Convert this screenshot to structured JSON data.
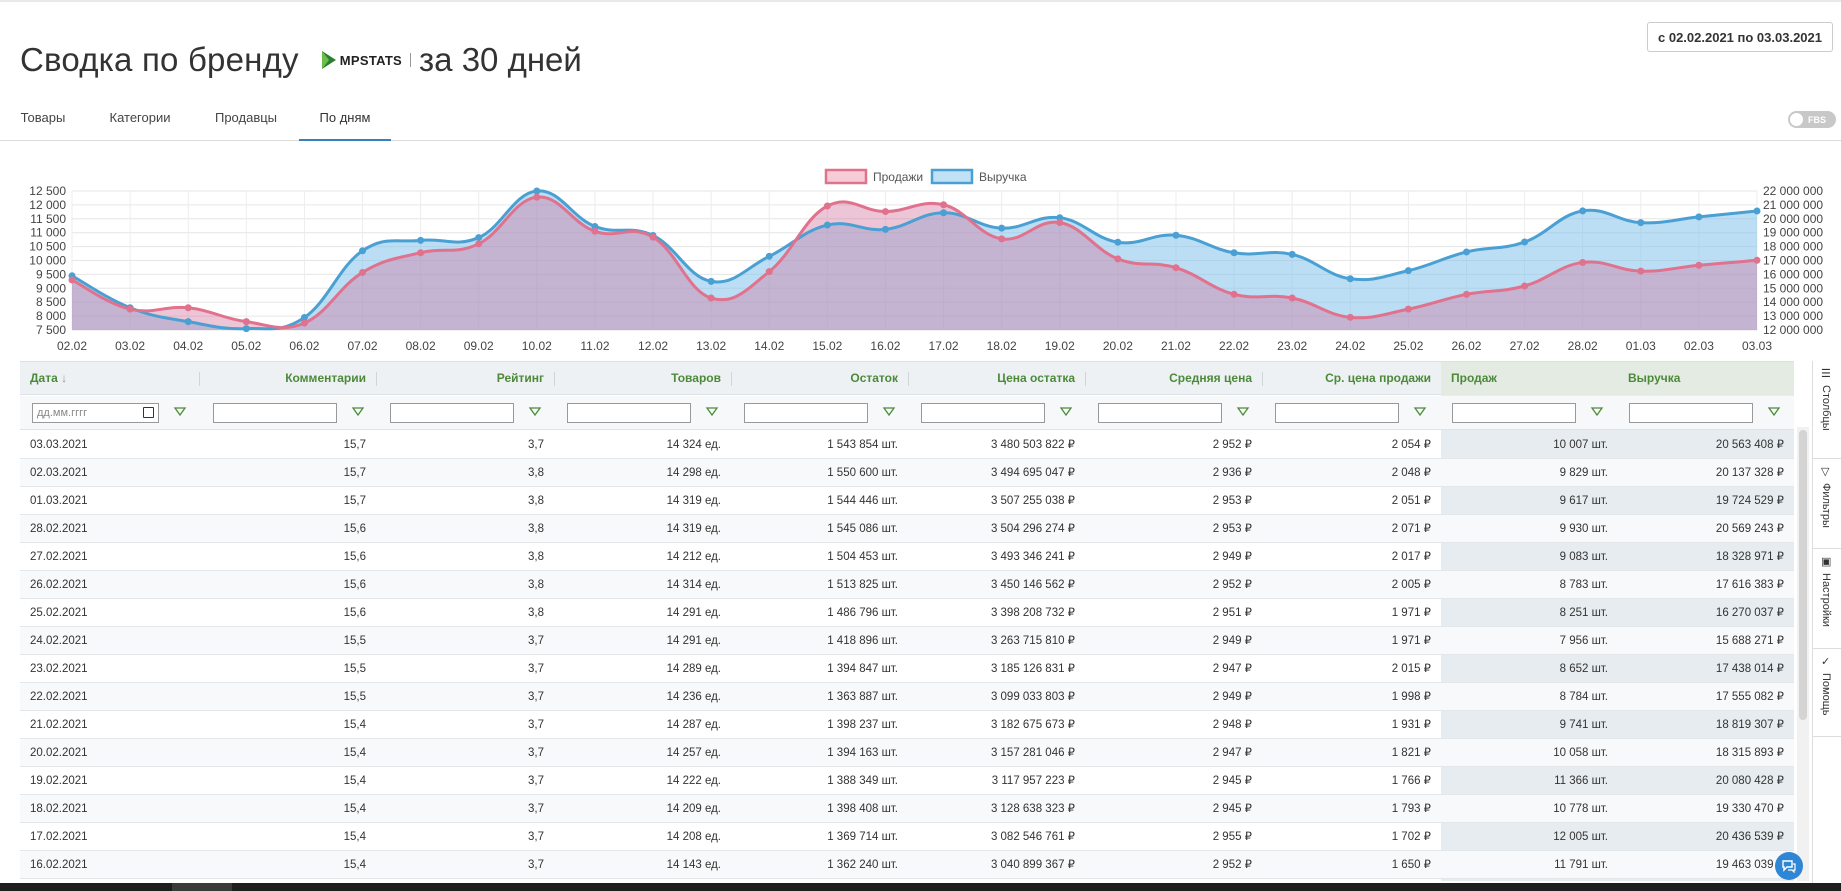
{
  "header": {
    "title": "Сводка по бренду",
    "logo_text": "MPSTATS",
    "title_suffix": "за 30 дней",
    "date_range": "с 02.02.2021 по 03.03.2021"
  },
  "tabs": [
    {
      "label": "Товары",
      "active": false
    },
    {
      "label": "Категории",
      "active": false
    },
    {
      "label": "Продавцы",
      "active": false
    },
    {
      "label": "По дням",
      "active": true
    }
  ],
  "fbs_toggle": {
    "label": "FBS",
    "on": false
  },
  "colors": {
    "accent": "#3a7fbd",
    "sales": "#e0728d",
    "revenue": "#4aa0d2",
    "header_text": "#4c8a3a"
  },
  "chart_data": {
    "type": "area",
    "legend": [
      "Продажи",
      "Выручка"
    ],
    "legend_position": "top-center",
    "x": [
      "02.02",
      "03.02",
      "04.02",
      "05.02",
      "06.02",
      "07.02",
      "08.02",
      "09.02",
      "10.02",
      "11.02",
      "12.02",
      "13.02",
      "14.02",
      "15.02",
      "16.02",
      "17.02",
      "18.02",
      "19.02",
      "20.02",
      "21.02",
      "22.02",
      "23.02",
      "24.02",
      "25.02",
      "26.02",
      "27.02",
      "28.02",
      "01.03",
      "02.03",
      "03.03"
    ],
    "y_left_ticks": [
      "12 500",
      "12 000",
      "11 500",
      "11 000",
      "10 500",
      "10 000",
      "9 500",
      "9 000",
      "8 500",
      "8 000",
      "7 500"
    ],
    "y_right_ticks": [
      "22 000 000",
      "21 000 000",
      "20 000 000",
      "19 000 000",
      "18 000 000",
      "17 000 000",
      "16 000 000",
      "15 000 000",
      "14 000 000",
      "13 000 000",
      "12 000 000"
    ],
    "ylim_left": [
      7500,
      12500
    ],
    "ylim_right": [
      12000000,
      22000000
    ],
    "grid": true,
    "series": [
      {
        "name": "Продажи",
        "axis": "left",
        "values": [
          9300,
          8250,
          8300,
          7800,
          7750,
          9570,
          10280,
          10600,
          12280,
          11050,
          10840,
          8650,
          9600,
          11960,
          11760,
          12005,
          10778,
          11366,
          10058,
          9741,
          8784,
          8652,
          7956,
          8251,
          8783,
          9083,
          9930,
          9617,
          9829,
          10007
        ]
      },
      {
        "name": "Выручка",
        "axis": "right",
        "values": [
          15900,
          13600,
          12600,
          12100,
          12900,
          17700,
          18450,
          18650,
          22000,
          19450,
          18800,
          15500,
          17300,
          19550,
          19240,
          20437,
          19330,
          20080,
          18316,
          18819,
          17555,
          17438,
          15688,
          16270,
          17616,
          18329,
          20569,
          19725,
          20137,
          20563
        ]
      }
    ]
  },
  "table": {
    "columns": [
      "Дата",
      "Комментарии",
      "Рейтинг",
      "Товаров",
      "Остаток",
      "Цена остатка",
      "Средняя цена",
      "Ср. цена продажи",
      "Продаж",
      "Выручка"
    ],
    "date_placeholder": "дд.мм.гггг",
    "rows": [
      [
        "03.03.2021",
        "15,7",
        "3,7",
        "14 324 ед.",
        "1 543 854 шт.",
        "3 480 503 822 ₽",
        "2 952 ₽",
        "2 054 ₽",
        "10 007 шт.",
        "20 563 408 ₽"
      ],
      [
        "02.03.2021",
        "15,7",
        "3,8",
        "14 298 ед.",
        "1 550 600 шт.",
        "3 494 695 047 ₽",
        "2 936 ₽",
        "2 048 ₽",
        "9 829 шт.",
        "20 137 328 ₽"
      ],
      [
        "01.03.2021",
        "15,7",
        "3,8",
        "14 319 ед.",
        "1 544 446 шт.",
        "3 507 255 038 ₽",
        "2 953 ₽",
        "2 051 ₽",
        "9 617 шт.",
        "19 724 529 ₽"
      ],
      [
        "28.02.2021",
        "15,6",
        "3,8",
        "14 319 ед.",
        "1 545 086 шт.",
        "3 504 296 274 ₽",
        "2 953 ₽",
        "2 071 ₽",
        "9 930 шт.",
        "20 569 243 ₽"
      ],
      [
        "27.02.2021",
        "15,6",
        "3,8",
        "14 212 ед.",
        "1 504 453 шт.",
        "3 493 346 241 ₽",
        "2 949 ₽",
        "2 017 ₽",
        "9 083 шт.",
        "18 328 971 ₽"
      ],
      [
        "26.02.2021",
        "15,6",
        "3,8",
        "14 314 ед.",
        "1 513 825 шт.",
        "3 450 146 562 ₽",
        "2 952 ₽",
        "2 005 ₽",
        "8 783 шт.",
        "17 616 383 ₽"
      ],
      [
        "25.02.2021",
        "15,6",
        "3,8",
        "14 291 ед.",
        "1 486 796 шт.",
        "3 398 208 732 ₽",
        "2 951 ₽",
        "1 971 ₽",
        "8 251 шт.",
        "16 270 037 ₽"
      ],
      [
        "24.02.2021",
        "15,5",
        "3,7",
        "14 291 ед.",
        "1 418 896 шт.",
        "3 263 715 810 ₽",
        "2 949 ₽",
        "1 971 ₽",
        "7 956 шт.",
        "15 688 271 ₽"
      ],
      [
        "23.02.2021",
        "15,5",
        "3,7",
        "14 289 ед.",
        "1 394 847 шт.",
        "3 185 126 831 ₽",
        "2 947 ₽",
        "2 015 ₽",
        "8 652 шт.",
        "17 438 014 ₽"
      ],
      [
        "22.02.2021",
        "15,5",
        "3,7",
        "14 236 ед.",
        "1 363 887 шт.",
        "3 099 033 803 ₽",
        "2 949 ₽",
        "1 998 ₽",
        "8 784 шт.",
        "17 555 082 ₽"
      ],
      [
        "21.02.2021",
        "15,4",
        "3,7",
        "14 287 ед.",
        "1 398 237 шт.",
        "3 182 675 673 ₽",
        "2 948 ₽",
        "1 931 ₽",
        "9 741 шт.",
        "18 819 307 ₽"
      ],
      [
        "20.02.2021",
        "15,4",
        "3,7",
        "14 257 ед.",
        "1 394 163 шт.",
        "3 157 281 046 ₽",
        "2 947 ₽",
        "1 821 ₽",
        "10 058 шт.",
        "18 315 893 ₽"
      ],
      [
        "19.02.2021",
        "15,4",
        "3,7",
        "14 222 ед.",
        "1 388 349 шт.",
        "3 117 957 223 ₽",
        "2 945 ₽",
        "1 766 ₽",
        "11 366 шт.",
        "20 080 428 ₽"
      ],
      [
        "18.02.2021",
        "15,4",
        "3,7",
        "14 209 ед.",
        "1 398 408 шт.",
        "3 128 638 323 ₽",
        "2 945 ₽",
        "1 793 ₽",
        "10 778 шт.",
        "19 330 470 ₽"
      ],
      [
        "17.02.2021",
        "15,4",
        "3,7",
        "14 208 ед.",
        "1 369 714 шт.",
        "3 082 546 761 ₽",
        "2 955 ₽",
        "1 702 ₽",
        "12 005 шт.",
        "20 436 539 ₽"
      ],
      [
        "16.02.2021",
        "15,4",
        "3,7",
        "14 143 ед.",
        "1 362 240 шт.",
        "3 040 899 367 ₽",
        "2 952 ₽",
        "1 650 ₽",
        "11 791 шт.",
        "19 463 039 ₽"
      ]
    ]
  },
  "side_panel": [
    {
      "label": "Столбцы",
      "icon": "columns-icon"
    },
    {
      "label": "Фильтры",
      "icon": "filter-icon"
    },
    {
      "label": "Настройки",
      "icon": "settings-icon"
    },
    {
      "label": "Помощь",
      "icon": "check-icon"
    }
  ]
}
